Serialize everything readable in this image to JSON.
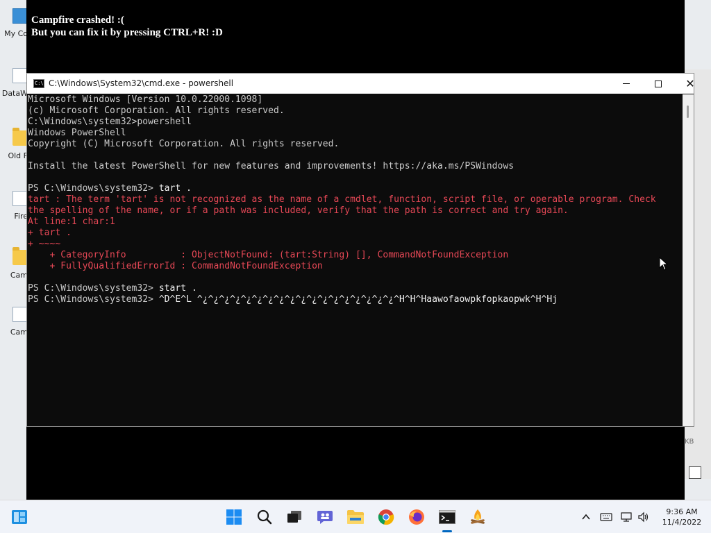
{
  "desktop": {
    "icons": [
      {
        "label": "My Co",
        "kind": "computer"
      },
      {
        "label": "DataW",
        "kind": "shortcut"
      },
      {
        "label": "Old F",
        "kind": "folder"
      },
      {
        "label": "Fire",
        "kind": "shortcut"
      },
      {
        "label": "Cam",
        "kind": "folder"
      },
      {
        "label": "Cam",
        "kind": "shortcut"
      }
    ],
    "side_label": "KB"
  },
  "crash_window": {
    "line1": "Campfire crashed! :(",
    "line2": "But you can fix it by pressing CTRL+R! :D"
  },
  "cmd_window": {
    "title": "C:\\Windows\\System32\\cmd.exe - powershell",
    "app_icon_text": "C:\\",
    "lines": [
      {
        "text": "Microsoft Windows [Version 10.0.22000.1098]",
        "kind": "out"
      },
      {
        "text": "(c) Microsoft Corporation. All rights reserved.",
        "kind": "out"
      },
      {
        "text": "C:\\Windows\\system32>powershell",
        "kind": "out"
      },
      {
        "text": "Windows PowerShell",
        "kind": "out"
      },
      {
        "text": "Copyright (C) Microsoft Corporation. All rights reserved.",
        "kind": "out"
      },
      {
        "text": "",
        "kind": "out"
      },
      {
        "text": "Install the latest PowerShell for new features and improvements! https://aka.ms/PSWindows",
        "kind": "out"
      },
      {
        "text": "",
        "kind": "out"
      },
      {
        "text": "PS C:\\Windows\\system32> ",
        "cmd": "tart .",
        "kind": "prompt"
      },
      {
        "text": "tart : The term 'tart' is not recognized as the name of a cmdlet, function, script file, or operable program. Check",
        "kind": "err"
      },
      {
        "text": "the spelling of the name, or if a path was included, verify that the path is correct and try again.",
        "kind": "err"
      },
      {
        "text": "At line:1 char:1",
        "kind": "err"
      },
      {
        "text": "+ tart .",
        "kind": "err"
      },
      {
        "text": "+ ~~~~",
        "kind": "err"
      },
      {
        "text": "    + CategoryInfo          : ObjectNotFound: (tart:String) [], CommandNotFoundException",
        "kind": "err"
      },
      {
        "text": "    + FullyQualifiedErrorId : CommandNotFoundException",
        "kind": "err"
      },
      {
        "text": "",
        "kind": "out"
      },
      {
        "text": "PS C:\\Windows\\system32> ",
        "cmd": "start .",
        "kind": "prompt"
      },
      {
        "text": "PS C:\\Windows\\system32> ",
        "cmd": "^D^E^L ^¿^¿^¿^¿^¿^¿^¿^¿^¿^¿^¿^¿^¿^¿^¿^¿^¿^¿^H^H^Haawofaowpkfopkaopwk^H^Hj",
        "kind": "prompt"
      }
    ]
  },
  "taskbar": {
    "apps": [
      {
        "name": "widgets",
        "active": false
      },
      {
        "name": "start",
        "active": false
      },
      {
        "name": "search",
        "active": false
      },
      {
        "name": "task-view",
        "active": false
      },
      {
        "name": "chat",
        "active": false
      },
      {
        "name": "file-explorer",
        "active": false
      },
      {
        "name": "chrome",
        "active": false
      },
      {
        "name": "firefox",
        "active": false
      },
      {
        "name": "terminal",
        "active": true
      },
      {
        "name": "campfire",
        "active": false
      }
    ],
    "time": "9:36 AM",
    "date": "11/4/2022"
  },
  "colors": {
    "console_bg": "#0c0c0c",
    "console_text": "#cccccc",
    "error_text": "#e74856",
    "accent": "#0067c0"
  }
}
